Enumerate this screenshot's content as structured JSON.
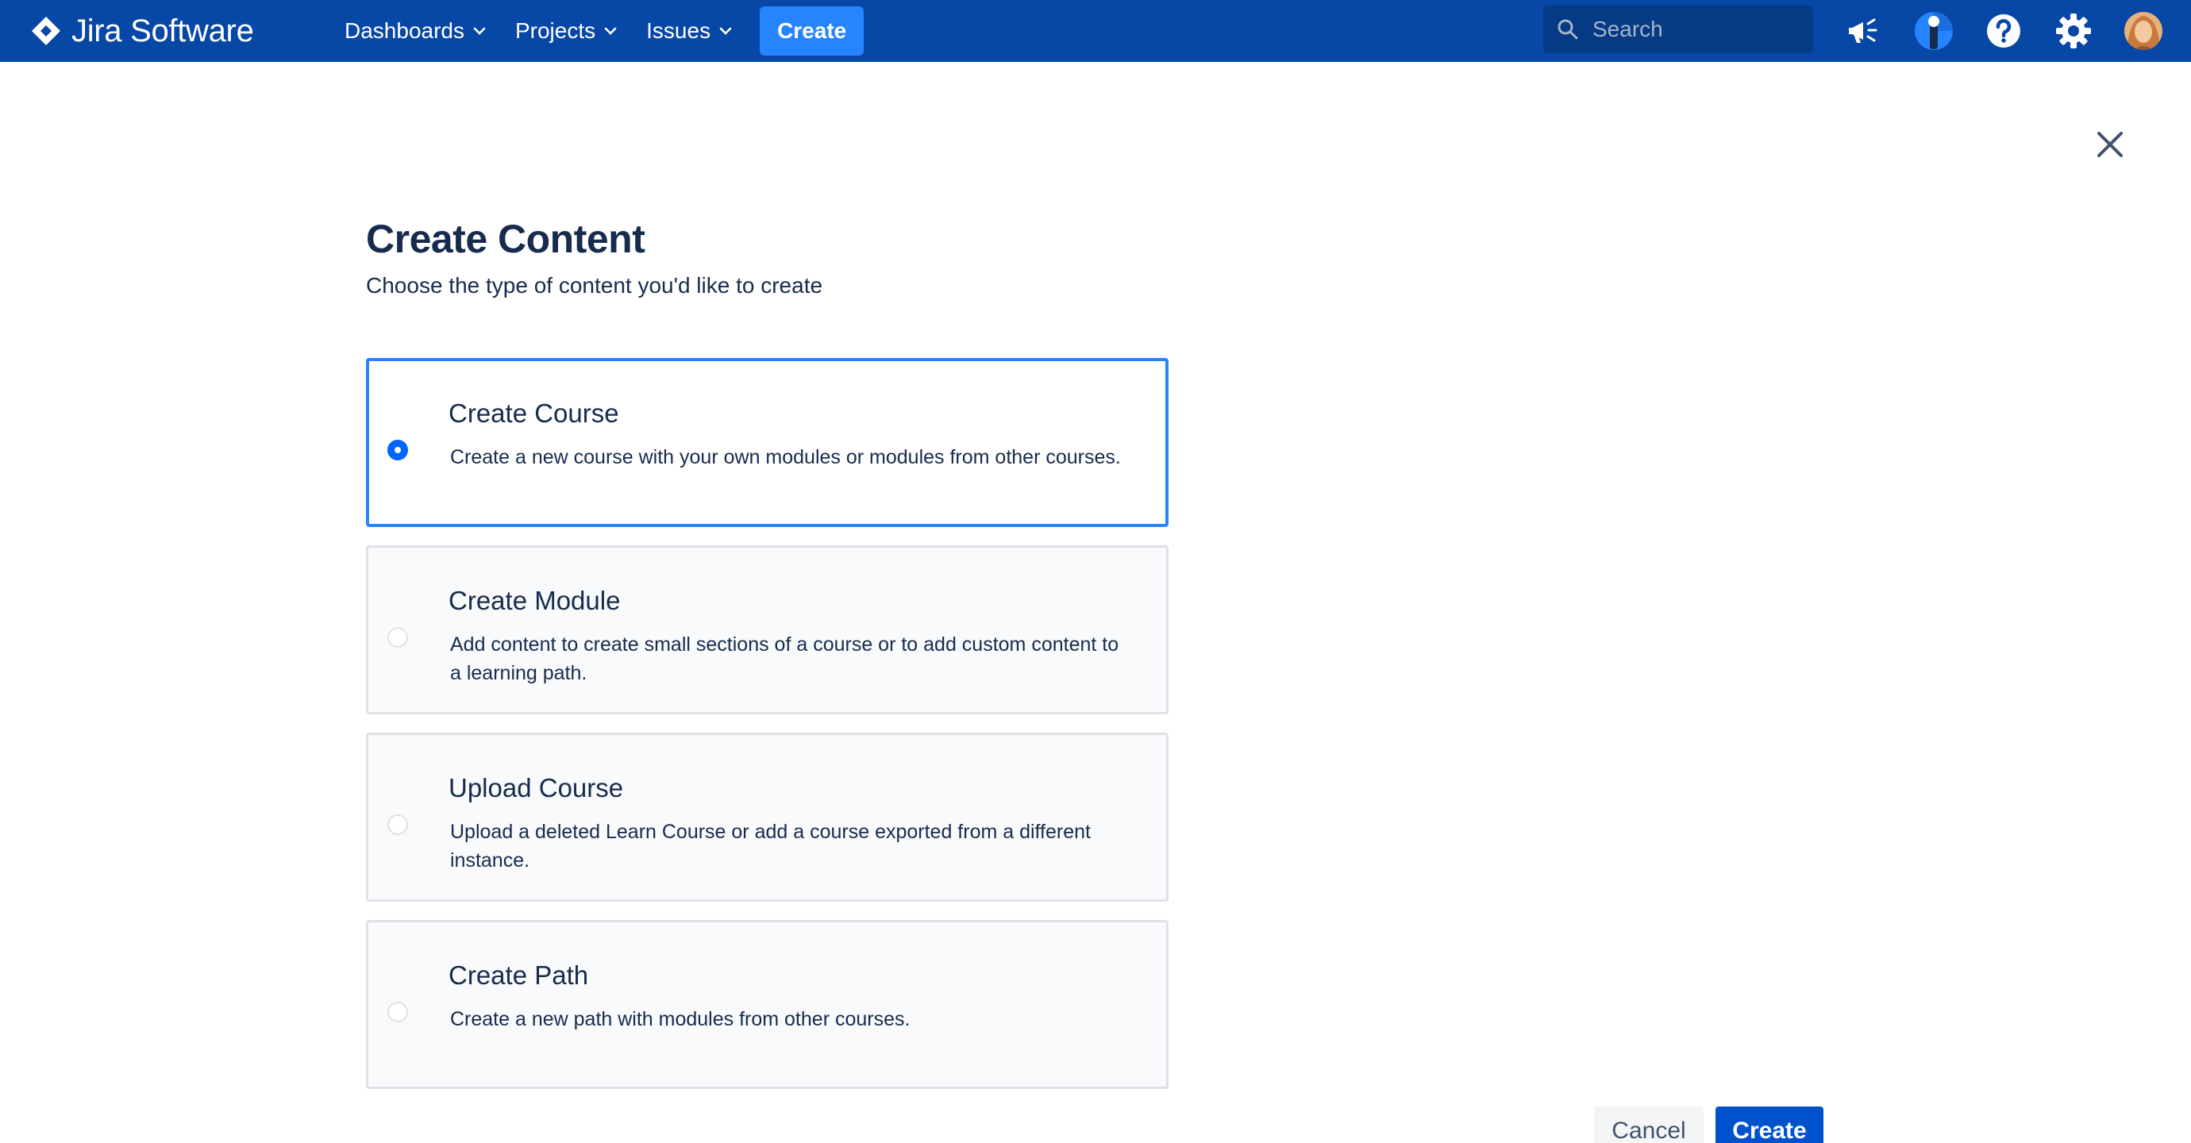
{
  "app": {
    "logo_text": "Jira Software",
    "brand_color": "#0747a6",
    "accent_color": "#2684ff"
  },
  "nav": {
    "items": [
      {
        "label": "Dashboards",
        "icon": "chevron-down-icon"
      },
      {
        "label": "Projects",
        "icon": "chevron-down-icon"
      },
      {
        "label": "Issues",
        "icon": "chevron-down-icon"
      }
    ],
    "create_label": "Create"
  },
  "search": {
    "placeholder": "Search",
    "icon": "search-icon"
  },
  "top_icons": [
    "megaphone-icon",
    "app-switcher-icon",
    "help-icon",
    "settings-icon",
    "avatar"
  ],
  "page": {
    "title": "Create Content",
    "subtitle": "Choose the type of content you'd like to create",
    "close_icon": "close-icon"
  },
  "options": [
    {
      "title": "Create Course",
      "description": "Create a new course with your own modules or modules from other courses.",
      "selected": true
    },
    {
      "title": "Create Module",
      "description": "Add content to create small sections of a course or to add custom content to a learning path.",
      "selected": false
    },
    {
      "title": "Upload Course",
      "description": "Upload a deleted Learn Course or add a course exported from a different instance.",
      "selected": false
    },
    {
      "title": "Create Path",
      "description": "Create a new path with modules from other courses.",
      "selected": false
    }
  ],
  "footer": {
    "cancel_label": "Cancel",
    "create_label": "Create"
  }
}
